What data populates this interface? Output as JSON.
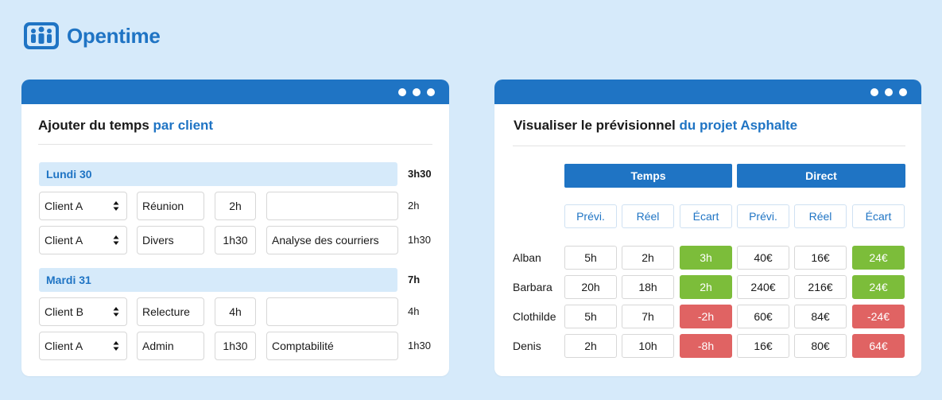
{
  "brand": {
    "name": "Opentime",
    "color": "#1f74c4"
  },
  "left_panel": {
    "heading_prefix": "Ajouter du temps ",
    "heading_accent": "par client",
    "days": [
      {
        "label": "Lundi 30",
        "total": "3h30",
        "rows": [
          {
            "client": "Client A",
            "task": "Réunion",
            "duration": "2h",
            "comment": "",
            "total": "2h"
          },
          {
            "client": "Client A",
            "task": "Divers",
            "duration": "1h30",
            "comment": "Analyse des courriers",
            "total": "1h30"
          }
        ]
      },
      {
        "label": "Mardi 31",
        "total": "7h",
        "rows": [
          {
            "client": "Client B",
            "task": "Relecture",
            "duration": "4h",
            "comment": "",
            "total": "4h"
          },
          {
            "client": "Client A",
            "task": "Admin",
            "duration": "1h30",
            "comment": "Comptabilité",
            "total": "1h30"
          }
        ]
      }
    ]
  },
  "right_panel": {
    "heading_prefix": "Visualiser le prévisionnel ",
    "heading_accent": "du projet Asphalte",
    "groups": [
      "Temps",
      "Direct"
    ],
    "columns": [
      "Prévi.",
      "Réel",
      "Écart",
      "Prévi.",
      "Réel",
      "Écart"
    ],
    "rows": [
      {
        "name": "Alban",
        "values": [
          "5h",
          "2h",
          "3h",
          "40€",
          "16€",
          "24€"
        ],
        "status": [
          "",
          "",
          "pos",
          "",
          "",
          "pos"
        ]
      },
      {
        "name": "Barbara",
        "values": [
          "20h",
          "18h",
          "2h",
          "240€",
          "216€",
          "24€"
        ],
        "status": [
          "",
          "",
          "pos",
          "",
          "",
          "pos"
        ]
      },
      {
        "name": "Clothilde",
        "values": [
          "5h",
          "7h",
          "-2h",
          "60€",
          "84€",
          "-24€"
        ],
        "status": [
          "",
          "",
          "neg",
          "",
          "",
          "neg"
        ]
      },
      {
        "name": "Denis",
        "values": [
          "2h",
          "10h",
          "-8h",
          "16€",
          "80€",
          "64€"
        ],
        "status": [
          "",
          "",
          "neg",
          "",
          "",
          "neg"
        ]
      }
    ]
  },
  "colors": {
    "accent": "#1f74c4",
    "positive": "#7cbd3a",
    "negative": "#e06363",
    "background": "#d6eafa"
  },
  "icons": {
    "logo": "people-group-icon",
    "select": "select-arrows-icon",
    "window_controls": "dots-icon"
  }
}
